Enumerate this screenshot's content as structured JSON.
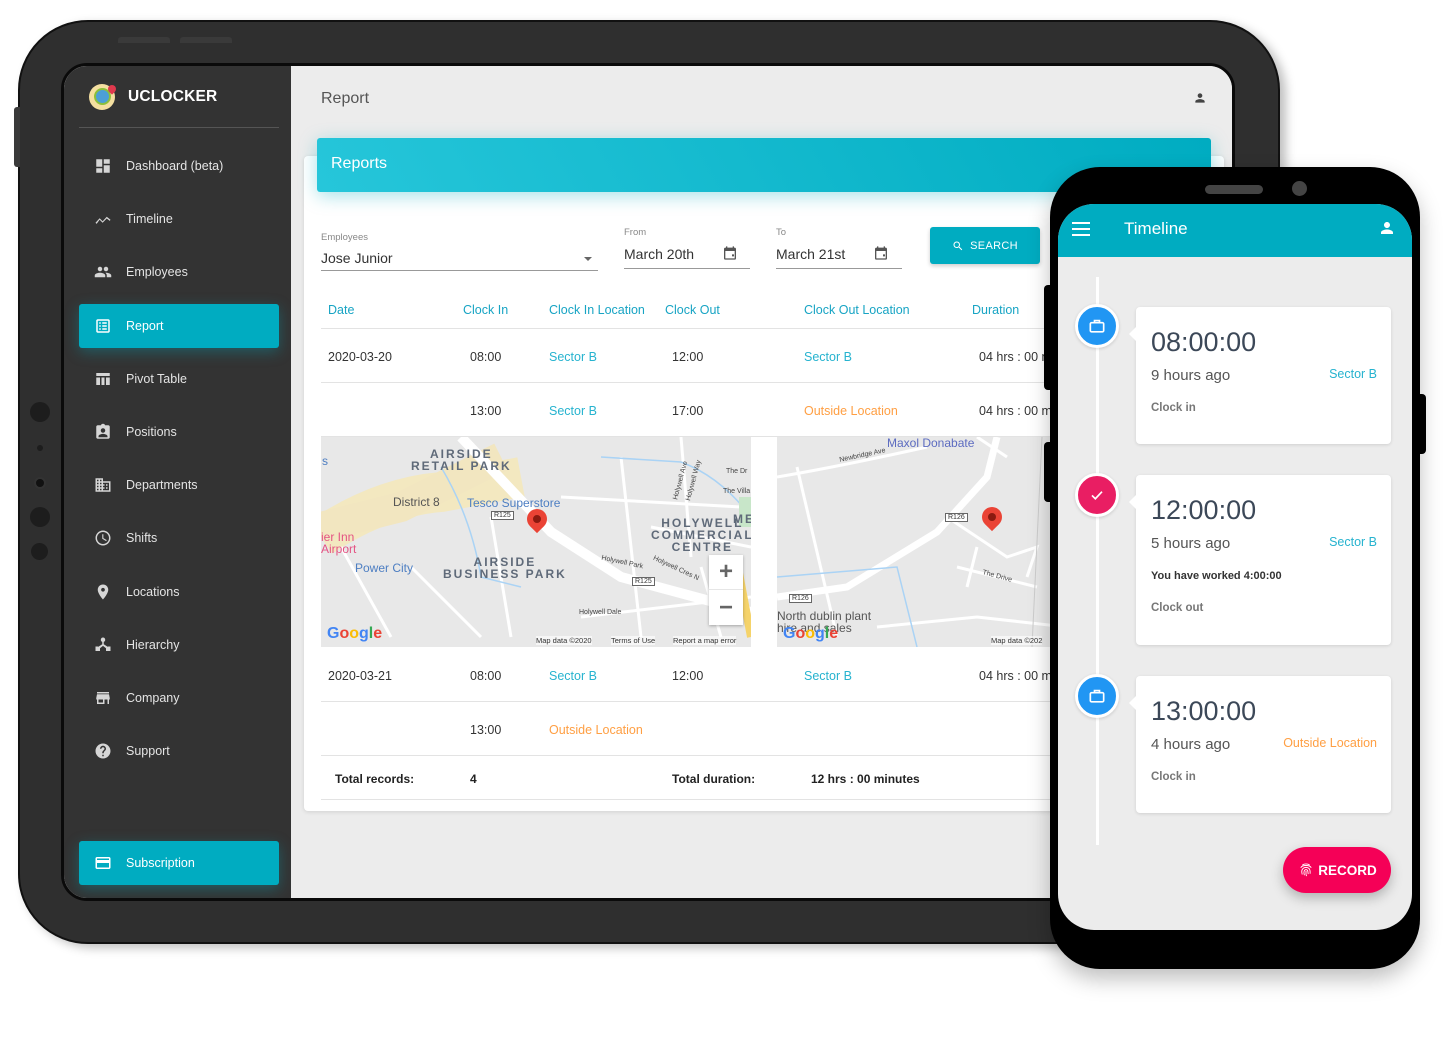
{
  "tablet": {
    "brand": {
      "name": "UCLOCKER",
      "logo_icon": "globe-pin-icon"
    },
    "sidebar": {
      "items": [
        {
          "label": "Dashboard (beta)",
          "icon": "dashboard-icon",
          "active": false
        },
        {
          "label": "Timeline",
          "icon": "timeline-icon",
          "active": false
        },
        {
          "label": "Employees",
          "icon": "people-icon",
          "active": false
        },
        {
          "label": "Report",
          "icon": "report-list-icon",
          "active": true
        },
        {
          "label": "Pivot Table",
          "icon": "table-icon",
          "active": false
        },
        {
          "label": "Positions",
          "icon": "badge-icon",
          "active": false
        },
        {
          "label": "Departments",
          "icon": "building-icon",
          "active": false
        },
        {
          "label": "Shifts",
          "icon": "clock-icon",
          "active": false
        },
        {
          "label": "Locations",
          "icon": "location-pin-icon",
          "active": false
        },
        {
          "label": "Hierarchy",
          "icon": "hierarchy-icon",
          "active": false
        },
        {
          "label": "Company",
          "icon": "store-icon",
          "active": false
        },
        {
          "label": "Support",
          "icon": "help-icon",
          "active": false
        }
      ],
      "subscription": {
        "label": "Subscription",
        "icon": "credit-card-icon"
      }
    },
    "topbar": {
      "title": "Report",
      "user_icon": "person-icon"
    },
    "card": {
      "header": "Reports",
      "filters": {
        "employees_label": "Employees",
        "employees_value": "Jose Junior",
        "from_label": "From",
        "from_value": "March 20th",
        "to_label": "To",
        "to_value": "March 21st",
        "search_label": "SEARCH"
      },
      "table": {
        "columns": [
          "Date",
          "Clock In",
          "Clock In Location",
          "Clock Out",
          "Clock Out Location",
          "Duration"
        ],
        "rows": [
          {
            "date": "2020-03-20",
            "clock_in": "08:00",
            "in_location": "Sector B",
            "clock_out": "12:00",
            "out_location": "Sector B",
            "duration": "04 hrs : 00 m"
          },
          {
            "date": "",
            "clock_in": "13:00",
            "in_location": "Sector B",
            "clock_out": "17:00",
            "out_location": "Outside Location",
            "duration": "04 hrs : 00 mi"
          },
          {
            "date": "2020-03-21",
            "clock_in": "08:00",
            "in_location": "Sector B",
            "clock_out": "12:00",
            "out_location": "Sector B",
            "duration": "04 hrs : 00 mi"
          },
          {
            "date": "",
            "clock_in": "13:00",
            "in_location": "Outside Location",
            "clock_out": "",
            "out_location": "",
            "duration": ""
          }
        ],
        "totals": {
          "records_label": "Total records:",
          "records_value": "4",
          "duration_label": "Total duration:",
          "duration_value": "12 hrs : 00 minutes"
        }
      },
      "maps": [
        {
          "labels": {
            "area1": "AIRSIDE\nRETAIL PARK",
            "area2": "AIRSIDE\nBUSINESS PARK",
            "area3": "HOLYWELL\nCOMMERCIAL\nCENTRE",
            "me": "ME",
            "poi_district": "District 8",
            "poi_tesco": "Tesco Superstore",
            "poi_power": "Power City",
            "poi_inn": "ier Inn\nAirport",
            "poi_s": "s",
            "road": "R125",
            "road2": "R125",
            "street1": "Holywell Park",
            "street2": "Holywell Cres N",
            "street3": "Holywell Dale",
            "street4": "The Dr",
            "street5": "The Villa",
            "street6": "Holywell Ave",
            "street7": "Holywell Way"
          },
          "attribution": [
            "Map data ©2020",
            "Terms of Use",
            "Report a map error"
          ],
          "zoom_in": "+",
          "zoom_out": "−",
          "logo": "Google"
        },
        {
          "labels": {
            "poi_maxol": "Maxol Donabate",
            "road": "R126",
            "road2": "R126",
            "street1": "Newbridge Ave",
            "street2": "The Drive",
            "poi_north": "North dublin plant\nhire and sales"
          },
          "attribution": [
            "Map data ©202"
          ],
          "logo": "Google"
        }
      ]
    }
  },
  "phone": {
    "appbar": {
      "title": "Timeline",
      "menu_icon": "hamburger-menu-icon",
      "user_icon": "person-icon"
    },
    "entries": [
      {
        "time": "08:00:00",
        "ago": "9 hours ago",
        "location": "Sector B",
        "location_type": "inside",
        "note": "",
        "type": "Clock in",
        "icon": "briefcase-icon"
      },
      {
        "time": "12:00:00",
        "ago": "5 hours ago",
        "location": "Sector B",
        "location_type": "inside",
        "note": "You have worked 4:00:00",
        "type": "Clock out",
        "icon": "check-icon"
      },
      {
        "time": "13:00:00",
        "ago": "4 hours ago",
        "location": "Outside Location",
        "location_type": "outside",
        "note": "",
        "type": "Clock in",
        "icon": "briefcase-icon"
      }
    ],
    "record_button": {
      "label": "RECORD",
      "icon": "fingerprint-icon"
    }
  },
  "colors": {
    "accent": "#00acc1",
    "location_inside": "#26b3cf",
    "location_outside": "#ff9f43",
    "clock_in_dot": "#2196f3",
    "clock_out_dot": "#e91e63",
    "record_button": "#f50057",
    "sidebar_bg": "#333333"
  }
}
